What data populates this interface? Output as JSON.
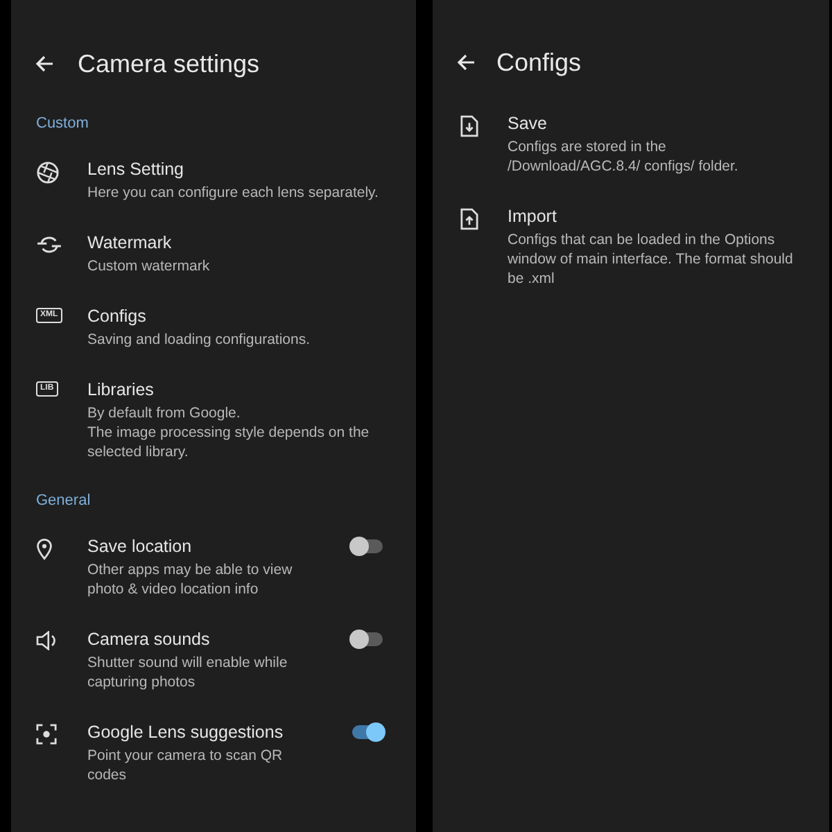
{
  "camera_settings": {
    "title": "Camera settings",
    "sections": [
      {
        "header": "Custom",
        "items": [
          {
            "kind": "link",
            "title": "Lens Setting",
            "subtitle": "Here you can configure each lens separately."
          },
          {
            "kind": "link",
            "title": "Watermark",
            "subtitle": "Custom watermark"
          },
          {
            "kind": "link",
            "title": "Configs",
            "subtitle": "Saving and loading configurations.",
            "icon_label": "XML"
          },
          {
            "kind": "link",
            "title": "Libraries",
            "subtitle": "By default from Google.\nThe image processing style depends on the selected library.",
            "icon_label": "LIB"
          }
        ]
      },
      {
        "header": "General",
        "items": [
          {
            "kind": "toggle",
            "title": "Save location",
            "subtitle": "Other apps may be able to view photo & video location info",
            "on": false
          },
          {
            "kind": "toggle",
            "title": "Camera sounds",
            "subtitle": "Shutter sound will enable while capturing photos",
            "on": false
          },
          {
            "kind": "toggle",
            "title": "Google Lens suggestions",
            "subtitle": "Point your camera to scan QR codes",
            "on": true
          }
        ]
      }
    ]
  },
  "configs": {
    "title": "Configs",
    "items": [
      {
        "title": "Save",
        "subtitle": "Configs are stored in the /Download/AGC.8.4/ configs/ folder."
      },
      {
        "title": "Import",
        "subtitle": "Configs that can be loaded in the Options window of main interface. The format should be .xml"
      }
    ]
  }
}
